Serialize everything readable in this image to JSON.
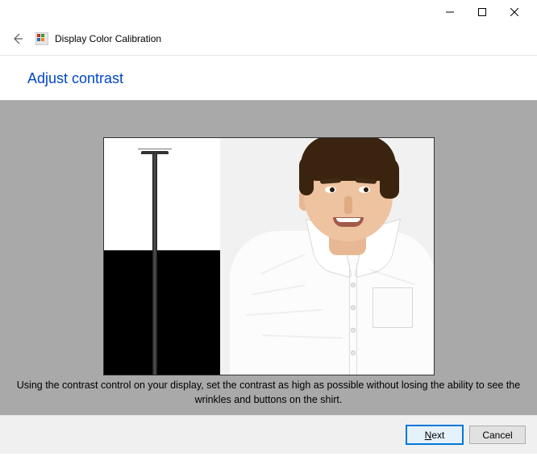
{
  "window": {
    "title": "Display Color Calibration"
  },
  "page": {
    "heading": "Adjust contrast",
    "instruction": "Using the contrast control on your display, set the contrast as high as possible without losing the ability to see the wrinkles and buttons on the shirt."
  },
  "buttons": {
    "next": "Next",
    "cancel": "Cancel"
  }
}
